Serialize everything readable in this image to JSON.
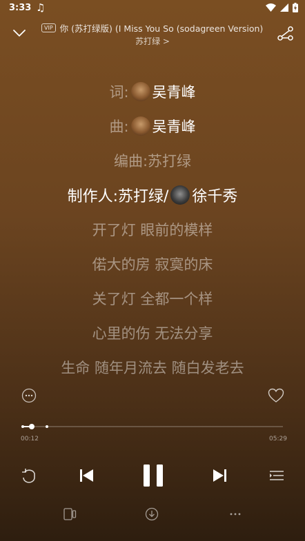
{
  "status_bar": {
    "time": "3:33",
    "music_icon": "music-note-icon",
    "right_icons": [
      "wifi-icon",
      "cellular-signal-icon",
      "battery-charging-icon"
    ]
  },
  "header": {
    "badge": "VIP",
    "title": "你 (苏打绿版) (I Miss You So (sodagreen Version)",
    "artist": "苏打绿 >"
  },
  "lyrics": {
    "credit_lyricist_label": "词:",
    "credit_lyricist_name": "吴青峰",
    "credit_composer_label": "曲:",
    "credit_composer_name": "吴青峰",
    "credit_arranger": "编曲:苏打绿",
    "credit_producer_label": "制作人:苏打绿/",
    "credit_producer_name": "徐千秀",
    "line1": "开了灯 眼前的模样",
    "line2": "偌大的房 寂寞的床",
    "line3": "关了灯 全都一个样",
    "line4": "心里的伤 无法分享",
    "line5": "生命 随年月流去 随白发老去"
  },
  "player": {
    "current_time": "00:12",
    "duration": "05:29",
    "progress_fraction": 0.036
  }
}
